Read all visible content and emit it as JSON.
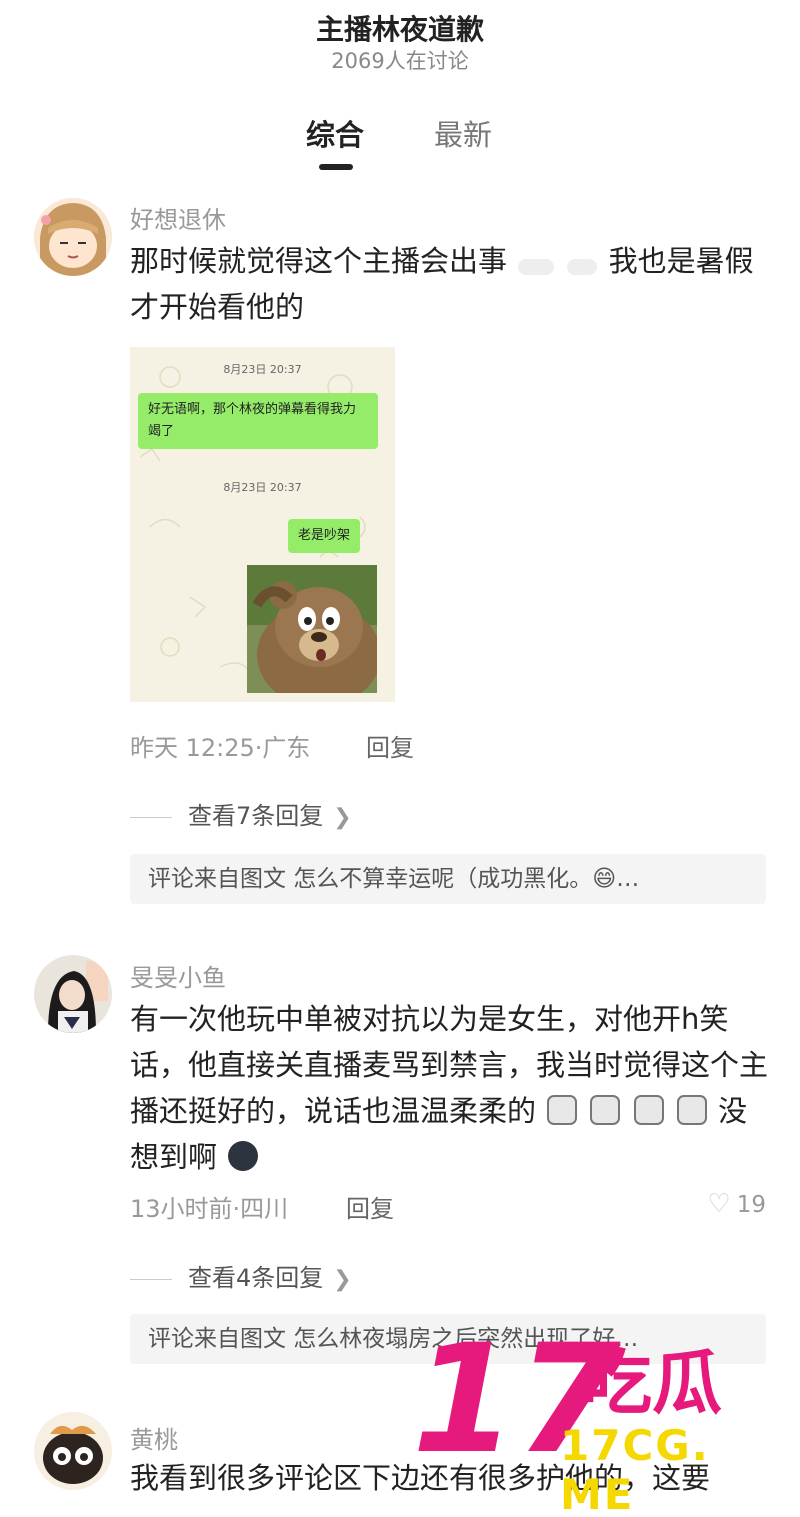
{
  "header": {
    "title": "主播林夜道歉",
    "subtitle": "2069人在讨论"
  },
  "tabs": [
    {
      "label": "综合"
    },
    {
      "label": "最新"
    }
  ],
  "comments": [
    {
      "username": "好想退休",
      "text_before_emoji": "那时候就觉得这个主播会出事",
      "text_after_emoji": "我也是暑假才开始看他的",
      "image": {
        "time1": "8月23日 20:37",
        "msg1": "好无语啊，那个林夜的弹幕看得我力竭了",
        "time2": "8月23日 20:37",
        "msg2": "老是吵架"
      },
      "meta": "昨天 12:25·广东",
      "reply": "回复",
      "view_replies": "查看7条回复",
      "source": "评论来自图文 怎么不算幸运呢（成功黑化。😄…"
    },
    {
      "username": "旻旻小鱼",
      "text1": "有一次他玩中单被对抗以为是女生，对他开h笑话，他直接关直播麦骂到禁言，我当时觉得这个主播还挺好的，说话也温温柔柔的",
      "text2": "没想到啊",
      "meta": "13小时前·四川",
      "reply": "回复",
      "likes": "19",
      "view_replies": "查看4条回复",
      "source": "评论来自图文 怎么林夜塌房之后突然出现了好…"
    },
    {
      "username": "黄桃",
      "text": "我看到很多评论区下边还有很多护他的，这要"
    }
  ],
  "watermark": {
    "number": "17",
    "chinese": "吃瓜",
    "url": "17CG. ME"
  },
  "colors": {
    "accent": "#e6197d",
    "watermark_url": "#f5d800",
    "bubble": "#95ec69"
  }
}
